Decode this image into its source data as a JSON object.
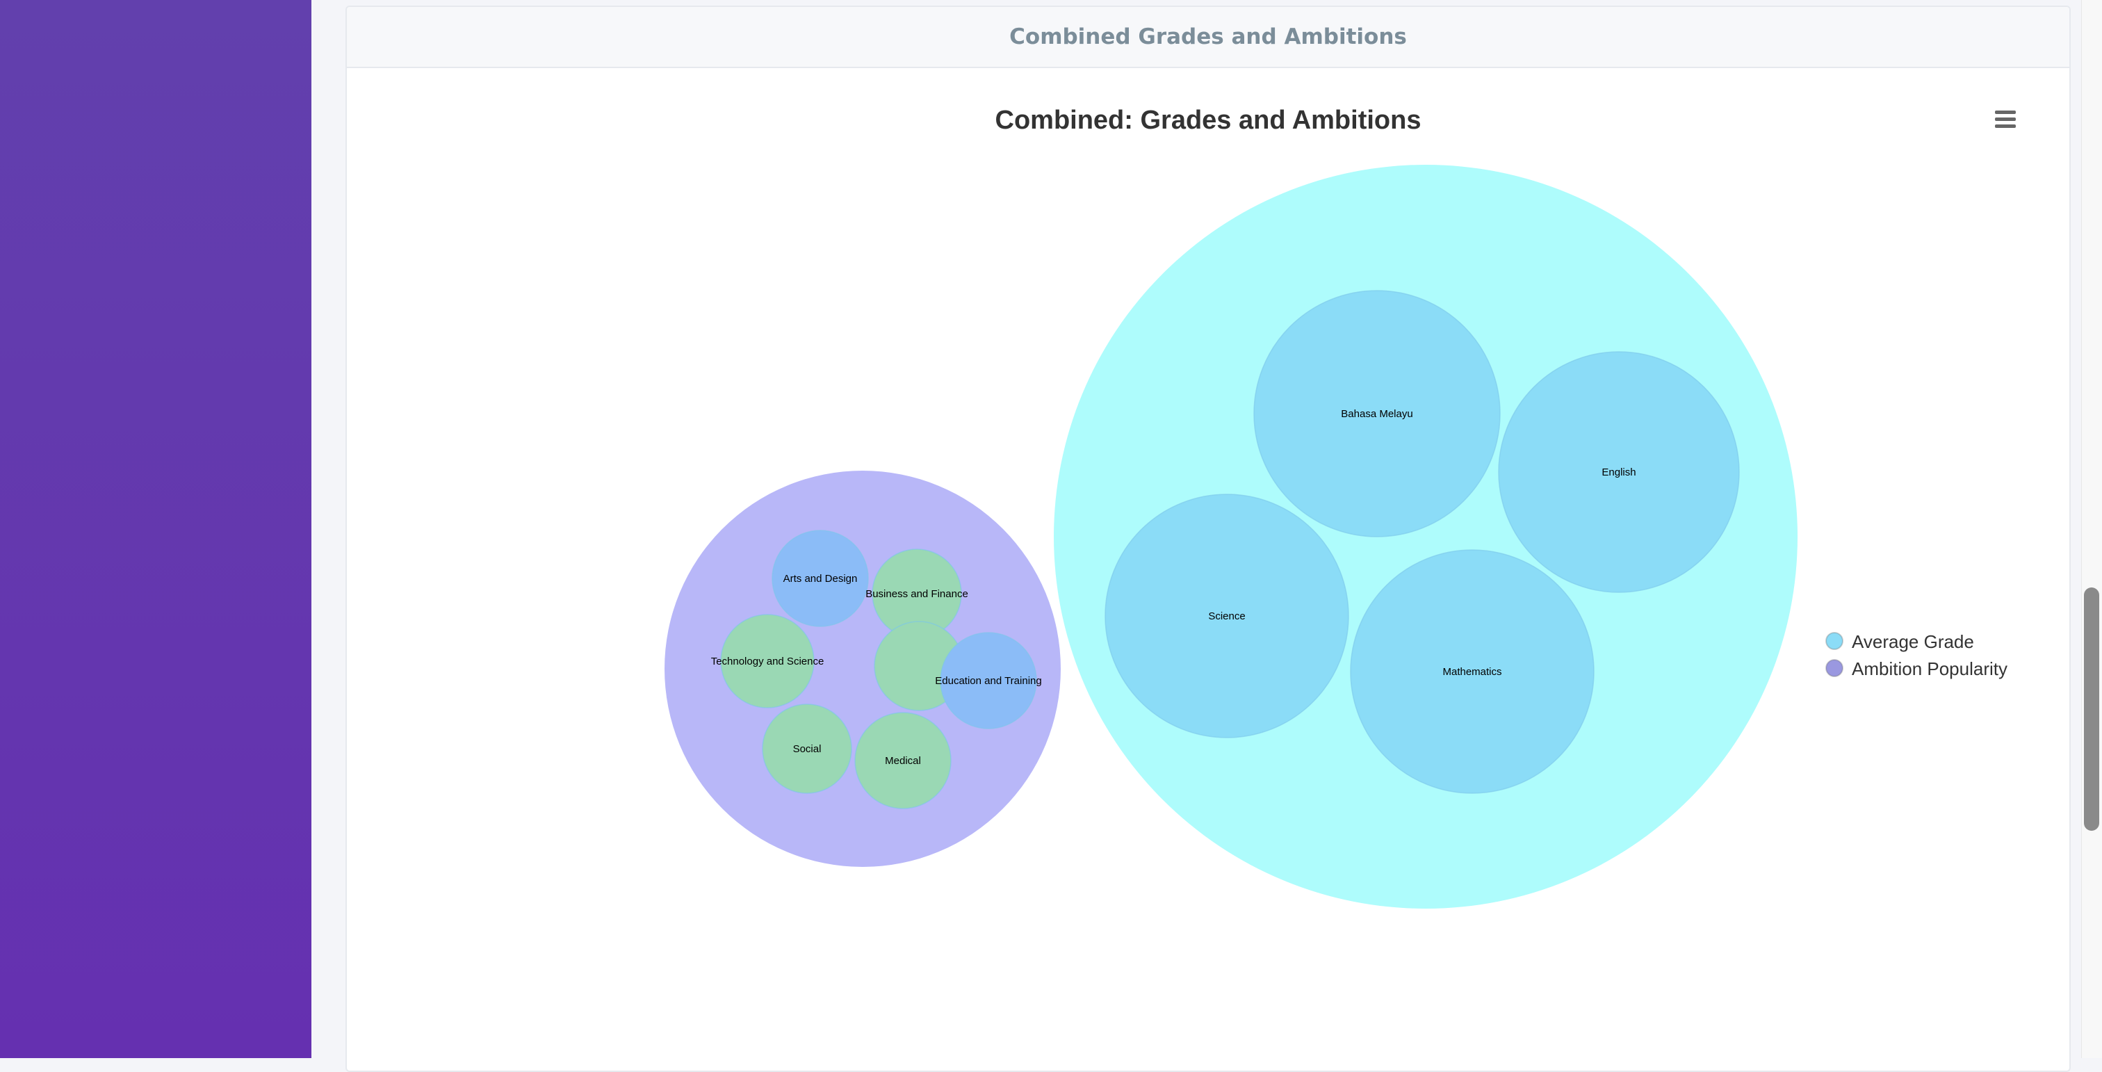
{
  "card": {
    "header_title": "Combined Grades and Ambitions"
  },
  "chart_data": {
    "type": "packed-bubble",
    "title": "Combined: Grades and Ambitions",
    "legend_position": "right",
    "series": [
      {
        "name": "Average Grade",
        "color": "#aefcfc",
        "marker_color": "#8bdcf7",
        "points": [
          {
            "name": "Bahasa Melayu",
            "value": 85
          },
          {
            "name": "English",
            "value": 82
          },
          {
            "name": "Science",
            "value": 84
          },
          {
            "name": "Mathematics",
            "value": 84
          }
        ]
      },
      {
        "name": "Ambition Popularity",
        "color": "#b8b7f8",
        "marker_color": "#9a98e0",
        "points": [
          {
            "name": "Arts and Design",
            "value": 2,
            "color": "#8bbcf7"
          },
          {
            "name": "Business and Finance",
            "value": 2,
            "color": "#9ad8b4"
          },
          {
            "name": "",
            "value": 2,
            "color": "#9ad8b4"
          },
          {
            "name": "Technology and Science",
            "value": 2,
            "color": "#9ad8b4"
          },
          {
            "name": "Education and Training",
            "value": 2,
            "color": "#8bbcf7"
          },
          {
            "name": "Social",
            "value": 2,
            "color": "#9ad8b4"
          },
          {
            "name": "Medical",
            "value": 2,
            "color": "#9ad8b4"
          }
        ]
      }
    ]
  },
  "menu": {
    "icon": "hamburger-menu-icon"
  }
}
